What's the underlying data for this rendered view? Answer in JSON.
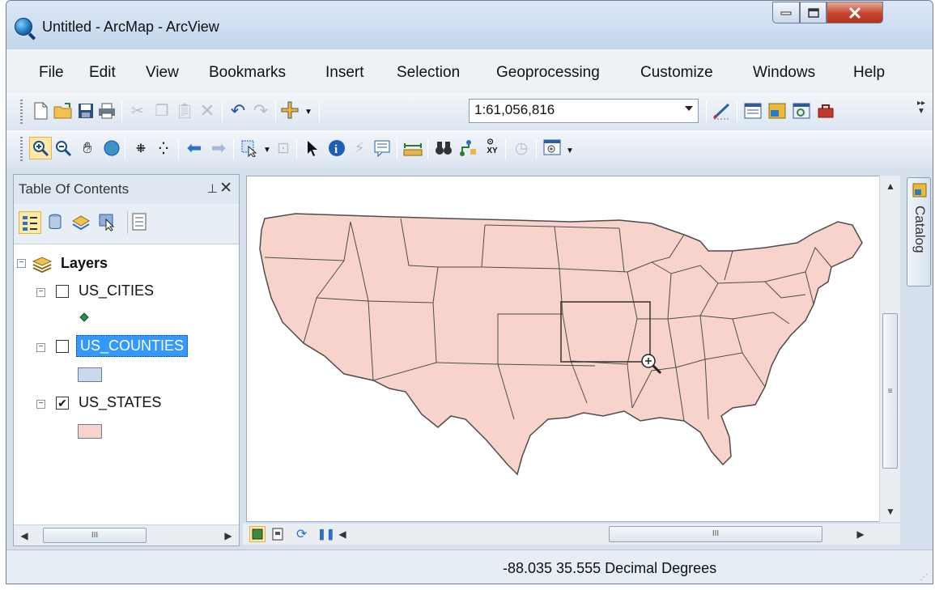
{
  "window": {
    "title": "Untitled - ArcMap - ArcView"
  },
  "menu": [
    "File",
    "Edit",
    "View",
    "Bookmarks",
    "Insert",
    "Selection",
    "Geoprocessing",
    "Customize",
    "Windows",
    "Help"
  ],
  "standard_toolbar": {
    "scale": "1:61,056,816"
  },
  "toc": {
    "title": "Table Of Contents",
    "root": "Layers",
    "layers": [
      {
        "name": "US_CITIES",
        "checked": false,
        "selected": false,
        "symbol": "green-point"
      },
      {
        "name": "US_COUNTIES",
        "checked": false,
        "selected": true,
        "symbol": "blue-fill"
      },
      {
        "name": "US_STATES",
        "checked": true,
        "selected": false,
        "symbol": "pink-fill"
      }
    ]
  },
  "catalog": {
    "label": "Catalog"
  },
  "status": {
    "coordinates": "-88.035  35.555 Decimal Degrees"
  },
  "colors": {
    "state_fill": "#f7d3cb",
    "county_fill": "#c9daf0",
    "selection": "#3399ff",
    "city_point": "#2e8b57"
  }
}
